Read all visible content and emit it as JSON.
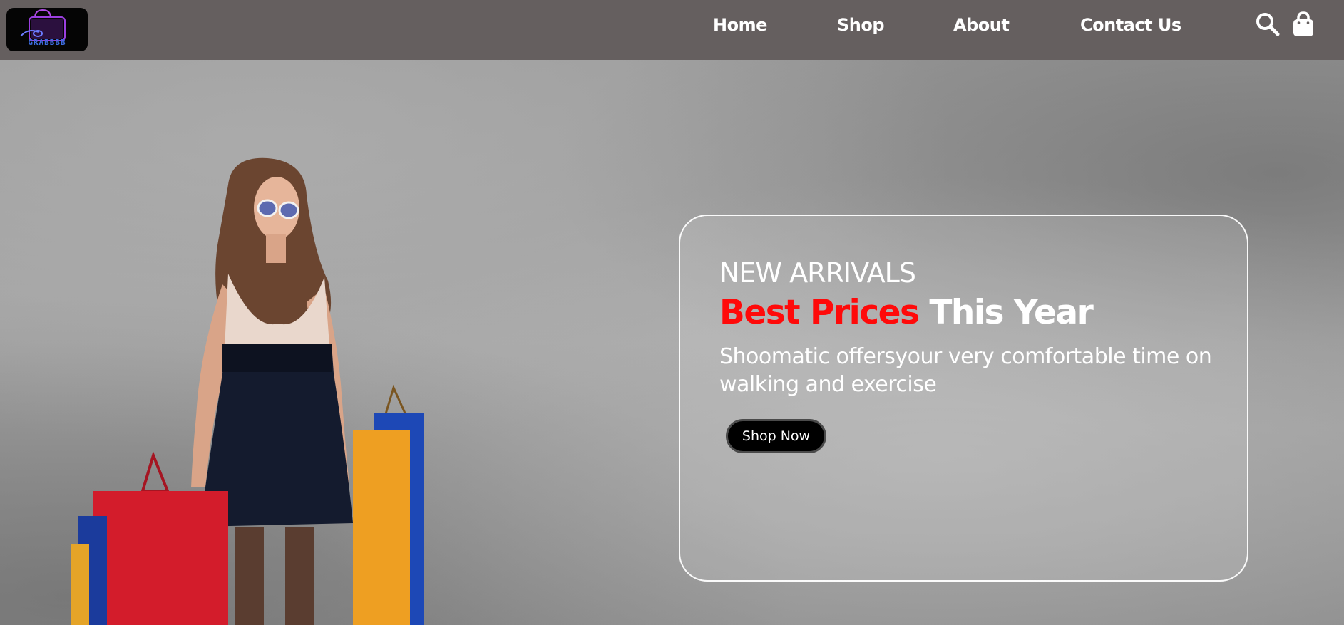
{
  "brand": {
    "logo_text": "GRABBBB",
    "logo_colors": {
      "bag": "#9b3fe0",
      "text": "#3d6de0"
    }
  },
  "nav": {
    "links": [
      {
        "label": "Home"
      },
      {
        "label": "Shop"
      },
      {
        "label": "About"
      },
      {
        "label": "Contact Us"
      }
    ],
    "icons": [
      "search-icon",
      "shopping-bag-icon"
    ]
  },
  "hero": {
    "eyebrow": "NEW ARRIVALS",
    "headline_accent": "Best Prices",
    "headline_rest": " This Year",
    "description": "Shoomatic offersyour very comfortable time on walking and exercise",
    "cta_label": "Shop Now",
    "colors": {
      "accent": "#ff0a0a",
      "header_bg": "#655f5f",
      "button_bg": "#000000"
    },
    "image_subject": "woman-with-shopping-bags"
  }
}
